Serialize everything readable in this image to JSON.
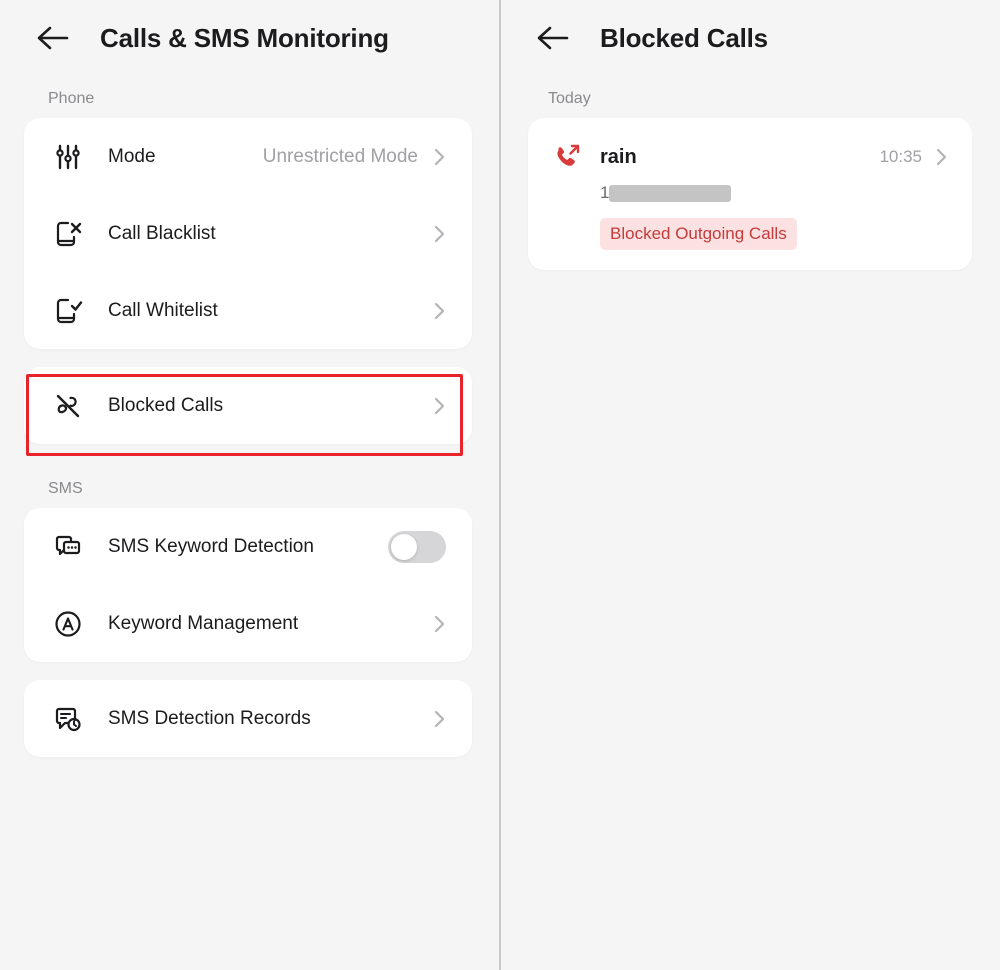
{
  "left_panel": {
    "header": {
      "back_icon": "arrow-left-icon",
      "title": "Calls & SMS Monitoring"
    },
    "sections": [
      {
        "label": "Phone",
        "cards": [
          {
            "rows": [
              {
                "icon": "sliders-icon",
                "label": "Mode",
                "value": "Unrestricted Mode",
                "accessory": "chevron"
              },
              {
                "icon": "phone-x-icon",
                "label": "Call Blacklist",
                "value": "",
                "accessory": "chevron"
              },
              {
                "icon": "phone-check-icon",
                "label": "Call Whitelist",
                "value": "",
                "accessory": "chevron"
              }
            ]
          },
          {
            "highlighted": true,
            "rows": [
              {
                "icon": "phone-off-icon",
                "label": "Blocked Calls",
                "value": "",
                "accessory": "chevron"
              }
            ]
          }
        ]
      },
      {
        "label": "SMS",
        "cards": [
          {
            "rows": [
              {
                "icon": "chat-dots-icon",
                "label": "SMS Keyword Detection",
                "value": "",
                "accessory": "toggle",
                "toggle_on": false
              },
              {
                "icon": "circle-a-icon",
                "label": "Keyword Management",
                "value": "",
                "accessory": "chevron"
              }
            ]
          },
          {
            "rows": [
              {
                "icon": "chat-clock-icon",
                "label": "SMS Detection Records",
                "value": "",
                "accessory": "chevron"
              }
            ]
          }
        ]
      }
    ]
  },
  "right_panel": {
    "header": {
      "back_icon": "arrow-left-icon",
      "title": "Blocked Calls"
    },
    "group_label": "Today",
    "records": [
      {
        "icon": "phone-outgoing-icon",
        "name": "rain",
        "time": "10:35",
        "number_prefix": "1",
        "number_redacted": true,
        "badge": "Blocked Outgoing Calls"
      }
    ]
  },
  "colors": {
    "background": "#f5f5f5",
    "card": "#ffffff",
    "primary_text": "#1c1c1e",
    "secondary_text": "#8a8a8e",
    "muted_value": "#a0a0a5",
    "highlight_border": "#e8232a",
    "accent_red": "#d93a3a",
    "badge_bg": "#fbe1e1",
    "badge_text": "#c63b3b",
    "toggle_off_track": "#d6d6d8",
    "divider": "#c9c9c9"
  }
}
